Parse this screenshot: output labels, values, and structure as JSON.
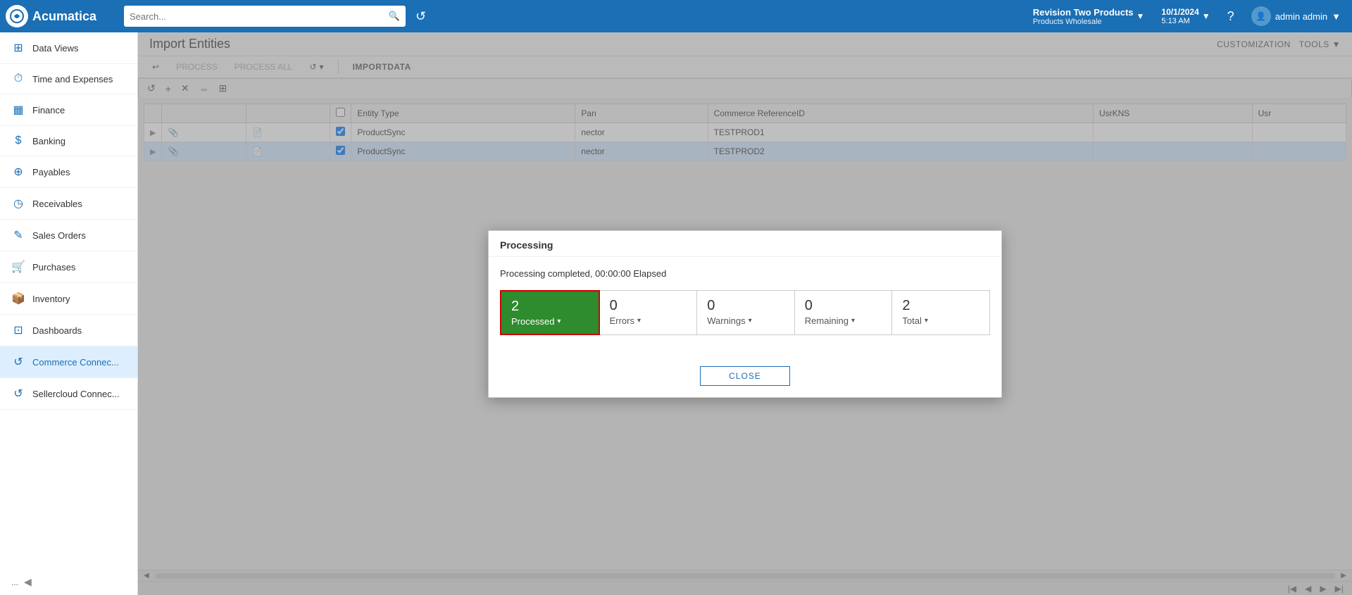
{
  "app": {
    "logo_text": "Acumatica",
    "search_placeholder": "Search..."
  },
  "company": {
    "name": "Revision Two Products",
    "sub": "Products Wholesale",
    "chevron": "▼"
  },
  "datetime": {
    "date": "10/1/2024",
    "time": "5:13 AM",
    "chevron": "▼"
  },
  "user": {
    "name": "admin admin",
    "chevron": "▼"
  },
  "sidebar": {
    "items": [
      {
        "id": "data-views",
        "label": "Data Views",
        "icon": "⊞"
      },
      {
        "id": "time-expenses",
        "label": "Time and Expenses",
        "icon": "⏱"
      },
      {
        "id": "finance",
        "label": "Finance",
        "icon": "📊"
      },
      {
        "id": "banking",
        "label": "Banking",
        "icon": "$"
      },
      {
        "id": "payables",
        "label": "Payables",
        "icon": "+"
      },
      {
        "id": "receivables",
        "label": "Receivables",
        "icon": "◷"
      },
      {
        "id": "sales-orders",
        "label": "Sales Orders",
        "icon": "✎"
      },
      {
        "id": "purchases",
        "label": "Purchases",
        "icon": "🛒"
      },
      {
        "id": "inventory",
        "label": "Inventory",
        "icon": "📦"
      },
      {
        "id": "dashboards",
        "label": "Dashboards",
        "icon": "⊡"
      },
      {
        "id": "commerce-connect",
        "label": "Commerce Connec...",
        "icon": "↺"
      },
      {
        "id": "sellercloud-connect",
        "label": "Sellercloud Connec...",
        "icon": "↺"
      }
    ],
    "more_label": "...",
    "collapse_icon": "◀"
  },
  "page": {
    "title": "Import Entities",
    "customization_label": "CUSTOMIZATION",
    "tools_label": "TOOLS"
  },
  "toolbar": {
    "undo_icon": "↩",
    "process_label": "PROCESS",
    "process_all_label": "PROCESS ALL",
    "refresh_icon": "↺",
    "import_data_label": "IMPORTDATA"
  },
  "table_toolbar": {
    "refresh_icon": "↺",
    "add_icon": "+",
    "delete_icon": "✕",
    "fit_icon": "⇔",
    "extra_icon": "⊞"
  },
  "table": {
    "columns": [
      {
        "id": "expander",
        "label": ""
      },
      {
        "id": "pin",
        "label": ""
      },
      {
        "id": "copy",
        "label": ""
      },
      {
        "id": "check",
        "label": ""
      },
      {
        "id": "entity-type",
        "label": "Entity Type"
      },
      {
        "id": "pan",
        "label": "Pan"
      },
      {
        "id": "commerce-ref",
        "label": "Commerce ReferenceID"
      },
      {
        "id": "usrkns",
        "label": "UsrKNS"
      },
      {
        "id": "usr",
        "label": "Usr"
      }
    ],
    "rows": [
      {
        "id": 1,
        "expander": "▶",
        "entity_type": "ProductSync",
        "connector": "nector",
        "commerce_ref": "TESTPROD1"
      },
      {
        "id": 2,
        "expander": "▶",
        "entity_type": "ProductSync",
        "connector": "nector",
        "commerce_ref": "TESTPROD2",
        "selected": true
      }
    ]
  },
  "modal": {
    "title": "Processing",
    "status_text": "Processing completed, 00:00:00 Elapsed",
    "stats": [
      {
        "id": "processed",
        "number": "2",
        "label": "Processed",
        "active": true
      },
      {
        "id": "errors",
        "number": "0",
        "label": "Errors",
        "active": false
      },
      {
        "id": "warnings",
        "number": "0",
        "label": "Warnings",
        "active": false
      },
      {
        "id": "remaining",
        "number": "0",
        "label": "Remaining",
        "active": false
      },
      {
        "id": "total",
        "number": "2",
        "label": "Total",
        "active": false
      }
    ],
    "close_label": "CLOSE"
  },
  "colors": {
    "brand": "#1a6fb5",
    "processed_bg": "#2e8b2e",
    "processed_border": "#cc0000",
    "sidebar_active": "#ddeeff"
  }
}
